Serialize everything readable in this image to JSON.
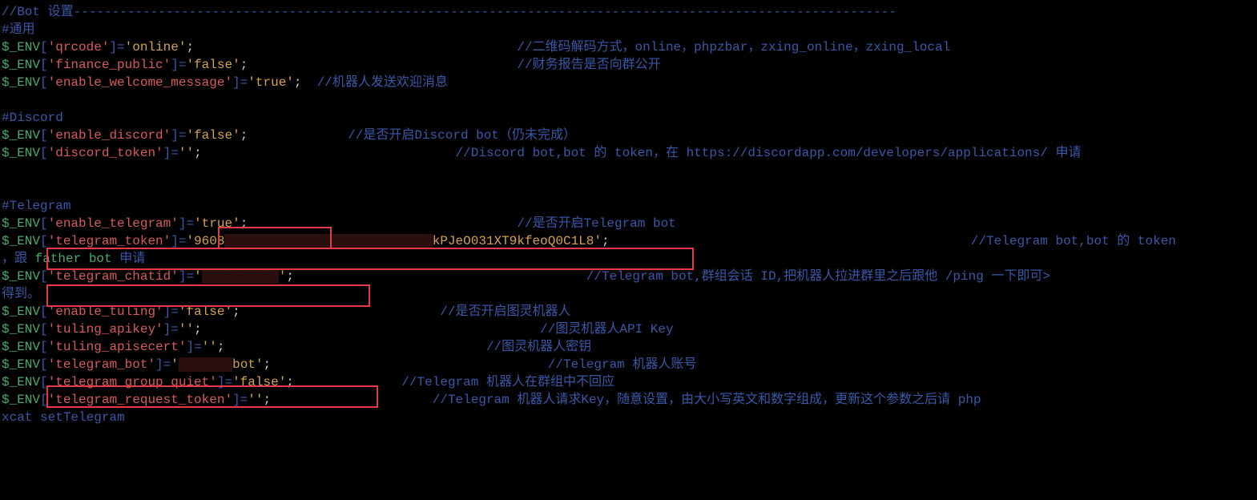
{
  "section_bot_title": "//Bot 设置-----------------------------------------------------------------------------------------------------------",
  "h_general": "#通用",
  "l_qrcode": {
    "k": "'qrcode'",
    "v": "'online'",
    "c": "//二维码解码方式，online，phpzbar，zxing_online，zxing_local"
  },
  "l_finance": {
    "k": "'finance_public'",
    "v": "'false'",
    "c": "//财务报告是否向群公开"
  },
  "l_welcome": {
    "k": "'enable_welcome_message'",
    "v": "'true'",
    "c": "//机器人发送欢迎消息"
  },
  "h_discord": "#Discord",
  "l_enable_discord": {
    "k": "'enable_discord'",
    "v": "'false'",
    "c": "//是否开启Discord bot（仍未完成）"
  },
  "l_discord_token": {
    "k": "'discord_token'",
    "v": "''",
    "c": "//Discord bot,bot 的 token，在 https://discordapp.com/developers/applications/ 申请"
  },
  "h_telegram": "#Telegram",
  "l_enable_telegram": {
    "k": "'enable_telegram'",
    "v": "'true'",
    "c": "//是否开启Telegram bot"
  },
  "l_telegram_token": {
    "k": "'telegram_token'",
    "v_open": "'9608",
    "v_redact": "XXXXXXXXXXXXXXXXXXXXXXXXXXX",
    "v_tail": "kPJeO031XT9kfeoQ0C1L8'",
    "c": "//Telegram bot,bot 的 token"
  },
  "l_telegram_token_cont": {
    "pre": "，跟 ",
    "father": "father bot",
    "post": " 申请"
  },
  "l_telegram_chatid": {
    "k": "'telegram_chatid'",
    "v_open": "'",
    "v_redact": "XXXXXXXXXX",
    "v_close": "'",
    "c": "//Telegram bot,群组会话 ID,把机器人拉进群里之后跟他 /ping 一下即可>"
  },
  "l_telegram_chatid_cont": "得到。",
  "l_enable_tuling": {
    "k": "'enable_tuling'",
    "v": "'false'",
    "c": "//是否开启图灵机器人"
  },
  "l_tuling_apikey": {
    "k": "'tuling_apikey'",
    "v": "''",
    "c": "//图灵机器人API Key"
  },
  "l_tuling_apisecert": {
    "k": "'tuling_apisecert'",
    "v": "''",
    "c": "//图灵机器人密钥"
  },
  "l_telegram_bot": {
    "k": "'telegram_bot'",
    "v_open": "'",
    "v_redact": "XXXXXXX",
    "v_tail": "bot'",
    "c": "//Telegram 机器人账号"
  },
  "l_telegram_group_quiet": {
    "k": "'telegram_group_quiet'",
    "v": "'false'",
    "c": "//Telegram 机器人在群组中不回应"
  },
  "l_telegram_request_token": {
    "k": "'telegram_request_token'",
    "v": "''",
    "c": "//Telegram 机器人请求Key，随意设置，由大小写英文和数字组成，更新这个参数之后请 php "
  },
  "l_xcat": "xcat setTelegram",
  "tok": {
    "env": "$_ENV",
    "lb": "[",
    "rb": "]",
    "eq": "=",
    "sc": ";"
  }
}
